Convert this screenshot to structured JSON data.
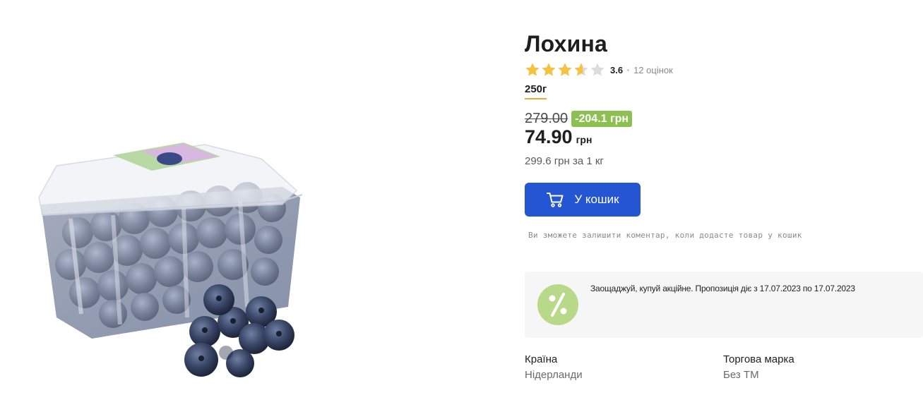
{
  "product": {
    "title": "Лохина",
    "rating": {
      "value": "3.6",
      "stars_filled": 3.6,
      "stars_total": 5,
      "count_label": "12 оцінок",
      "star_color": "#f5c242",
      "star_empty_color": "#dcdcdc"
    },
    "weight": "250г",
    "old_price": "279.00",
    "discount": "-204.1 грн",
    "price": "74.90",
    "currency": "грн",
    "unit_price": "299.6 грн за 1 кг",
    "image_icon": "blueberries-in-plastic-container"
  },
  "cart": {
    "button_label": "У кошик",
    "icon": "cart-icon",
    "hint": "Ви зможете залишити коментар, коли додасте товар у кошик"
  },
  "promo": {
    "icon": "percent-icon",
    "text": "Заощаджуй, купуй акційне. Пропозиція діє з 17.07.2023 по 17.07.2023"
  },
  "attributes": [
    {
      "label": "Країна",
      "value": "Нідерланди"
    },
    {
      "label": "Торгова марка",
      "value": "Без ТМ"
    }
  ],
  "colors": {
    "accent_blue": "#2455d2",
    "discount_green": "#8cc152",
    "weight_underline": "#f0a535",
    "promo_bg": "#f6f6f6",
    "promo_icon_bg": "#b9d98a"
  }
}
